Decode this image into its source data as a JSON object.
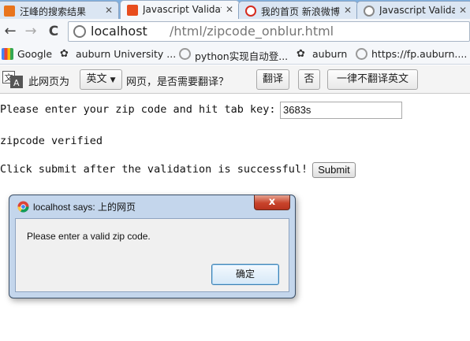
{
  "tabs": [
    {
      "title": "汪峰的搜索结果",
      "icon": "baidu-favicon-icon",
      "color": "#e8741d"
    },
    {
      "title": "Javascript Validat",
      "icon": "stackexchange-favicon-icon",
      "color": "#e84d1d"
    },
    {
      "title": "我的首页 新浪微博",
      "icon": "weibo-favicon-icon",
      "color": "#d52b1e"
    },
    {
      "title": "Javascript Validat",
      "icon": "page-favicon-icon",
      "color": "#888888"
    }
  ],
  "toolbar": {
    "back_glyph": "←",
    "forward_glyph": "→",
    "reload_glyph": "C",
    "url_host": "localhost",
    "url_path": "/html/zipcode_onblur.html"
  },
  "bookmarks": [
    {
      "label": "Google",
      "icon": "google-icon"
    },
    {
      "label": "auburn University ...",
      "icon": "auburn-paw-icon"
    },
    {
      "label": "python实现自动登...",
      "icon": "page-icon"
    },
    {
      "label": "auburn",
      "icon": "auburn-paw-icon"
    },
    {
      "label": "https://fp.auburn....",
      "icon": "page-icon"
    }
  ],
  "translate": {
    "prefix": "此网页为",
    "language": "英文",
    "question": "网页，是否需要翻译？",
    "translate_button": "翻译",
    "no_button": "否",
    "never_button": "一律不翻译英文"
  },
  "page": {
    "prompt": "Please enter your zip code and hit tab key:",
    "zip_value": "3683s",
    "verified": "zipcode verified",
    "instruction": "Click submit after the validation is successful!",
    "submit_label": "Submit"
  },
  "dialog": {
    "title": "localhost says: 上的网页",
    "message": "Please enter a valid zip code.",
    "ok_label": "确定",
    "close_glyph": "x"
  },
  "colors": {
    "tabstrip": "#7fb0e0",
    "dialog_frame": "#c4d6ec",
    "close_red": "#c8432b"
  }
}
